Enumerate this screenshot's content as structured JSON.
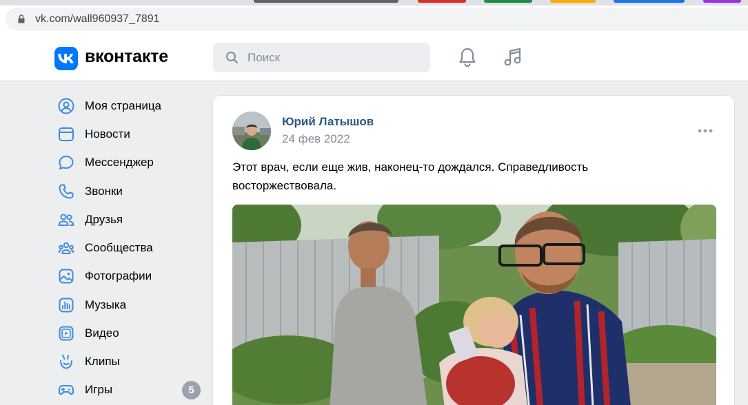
{
  "browser": {
    "url": "vk.com/wall960937_7891",
    "tab_colors": [
      "#5f6368",
      "#d93025",
      "#1e8e3e",
      "#f9ab00",
      "#1a73e8",
      "#9334e6"
    ]
  },
  "header": {
    "logo_text": "вконтакте",
    "search_placeholder": "Поиск",
    "brand_color": "#0077ff"
  },
  "sidebar": {
    "items": [
      {
        "label": "Моя страница",
        "icon": "user-circle-icon"
      },
      {
        "label": "Новости",
        "icon": "news-icon"
      },
      {
        "label": "Мессенджер",
        "icon": "message-icon"
      },
      {
        "label": "Звонки",
        "icon": "phone-icon"
      },
      {
        "label": "Друзья",
        "icon": "friends-icon"
      },
      {
        "label": "Сообщества",
        "icon": "communities-icon"
      },
      {
        "label": "Фотографии",
        "icon": "photo-icon"
      },
      {
        "label": "Музыка",
        "icon": "music-icon"
      },
      {
        "label": "Видео",
        "icon": "video-icon"
      },
      {
        "label": "Клипы",
        "icon": "clips-icon"
      },
      {
        "label": "Игры",
        "icon": "gamepad-icon",
        "badge": "5"
      }
    ]
  },
  "post": {
    "author": "Юрий Латышов",
    "date": "24 фев 2022",
    "text": "Этот врач, если еще жив, наконец-то дождался. Справедливость восторжествовала."
  }
}
